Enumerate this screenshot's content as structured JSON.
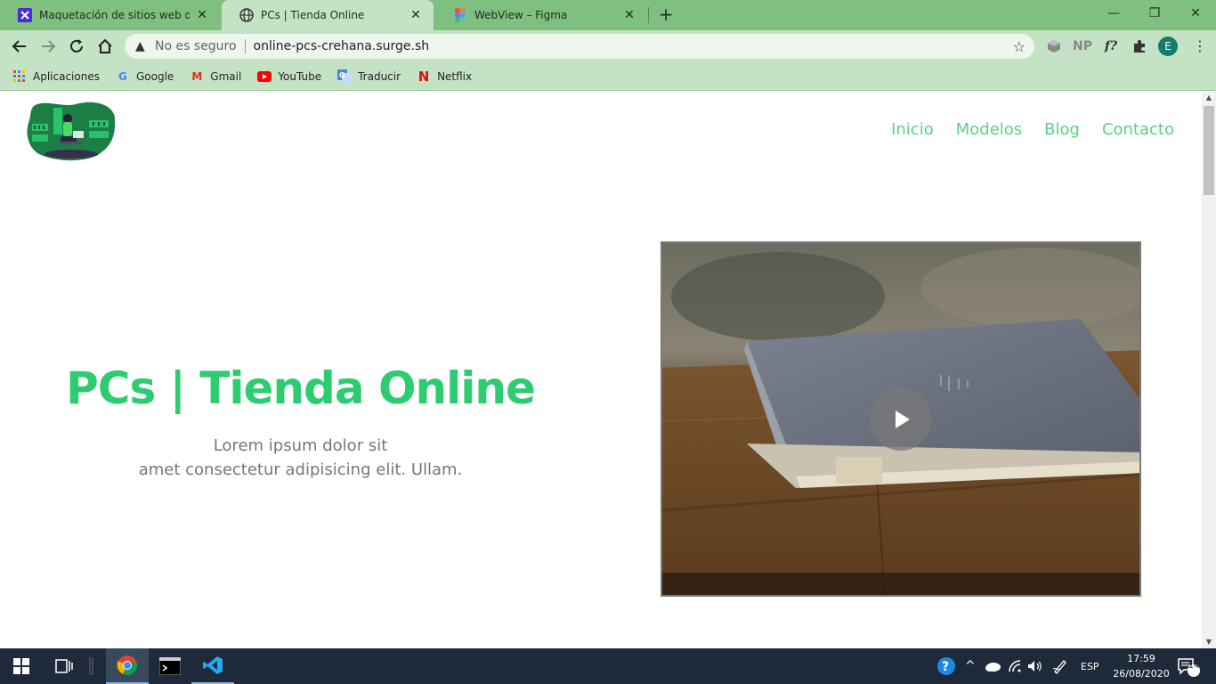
{
  "browser": {
    "tabs": [
      {
        "title": "Maquetación de sitios web dinám",
        "active": false,
        "favicon": "crehana-icon"
      },
      {
        "title": "PCs | Tienda Online",
        "active": true,
        "favicon": "globe-icon"
      },
      {
        "title": "WebView – Figma",
        "active": false,
        "favicon": "figma-icon"
      }
    ],
    "security_label": "No es seguro",
    "url": "online-pcs-crehana.surge.sh",
    "profile_initial": "E",
    "extensions": [
      "cube-icon",
      "NP",
      "f?",
      "puzzle-icon"
    ],
    "bookmarks": [
      {
        "label": "Aplicaciones",
        "icon": "apps-grid-icon"
      },
      {
        "label": "Google",
        "icon": "google-icon"
      },
      {
        "label": "Gmail",
        "icon": "gmail-icon"
      },
      {
        "label": "YouTube",
        "icon": "youtube-icon"
      },
      {
        "label": "Traducir",
        "icon": "translate-icon"
      },
      {
        "label": "Netflix",
        "icon": "netflix-icon"
      }
    ]
  },
  "page": {
    "nav": [
      "Inicio",
      "Modelos",
      "Blog",
      "Contacto"
    ],
    "hero": {
      "title": "PCs | Tienda Online",
      "subtitle_line1": "Lorem ipsum dolor sit",
      "subtitle_line2": "amet consectetur adipisicing elit. Ullam."
    },
    "colors": {
      "accent": "#2ecc71",
      "nav": "#5ccf86",
      "chrome_frame": "#7fbf7f",
      "chrome_toolbar": "#c4e3c4"
    }
  },
  "taskbar": {
    "language": "ESP",
    "time": "17:59",
    "date": "26/08/2020",
    "notifications": "14"
  }
}
